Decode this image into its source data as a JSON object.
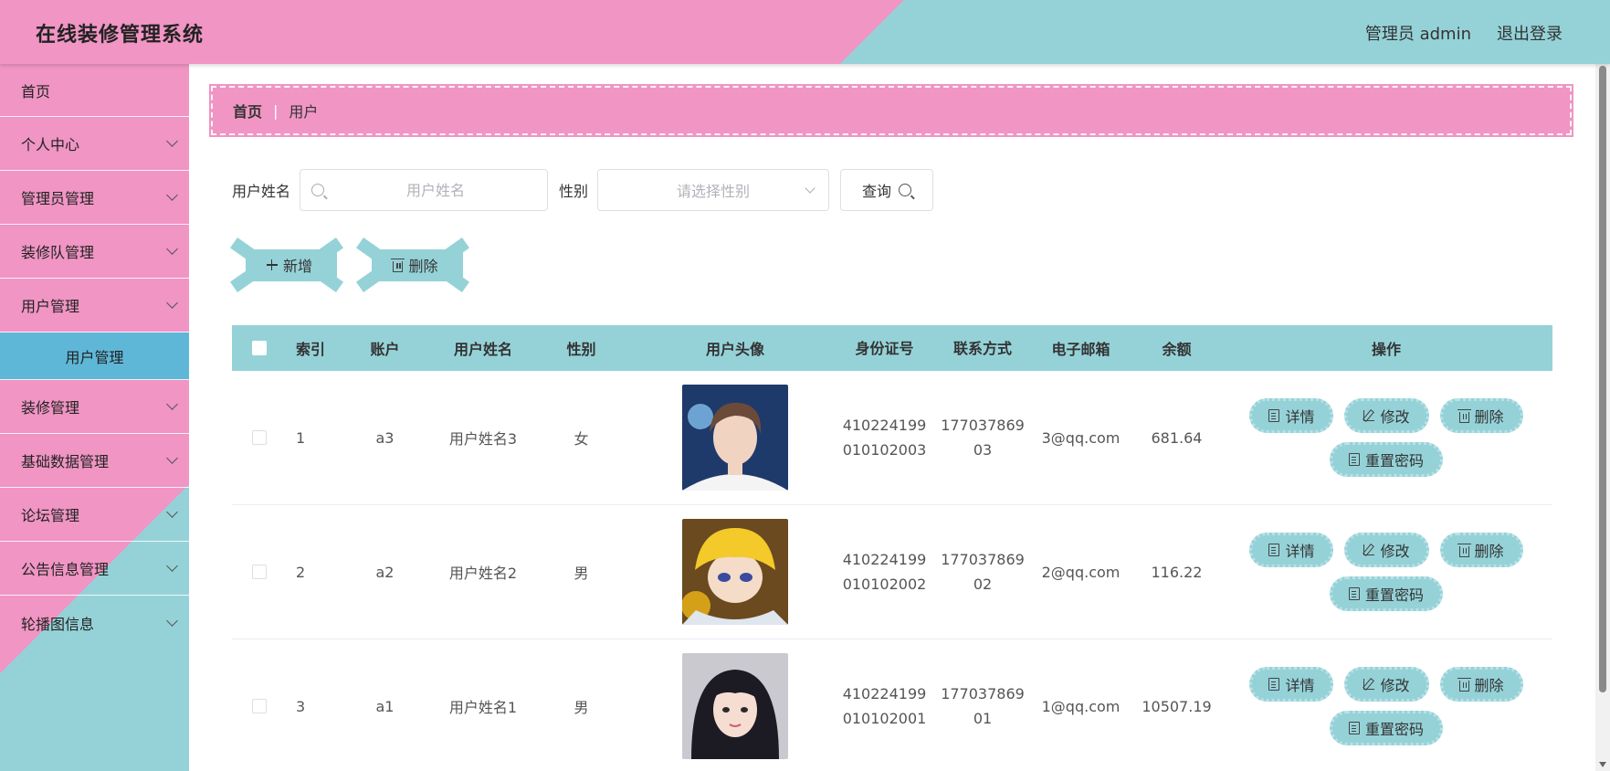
{
  "app": {
    "title": "在线装修管理系统"
  },
  "header": {
    "user_label": "管理员 admin",
    "logout_label": "退出登录"
  },
  "sidebar": {
    "items": [
      {
        "label": "首页"
      },
      {
        "label": "个人中心"
      },
      {
        "label": "管理员管理"
      },
      {
        "label": "装修队管理"
      },
      {
        "label": "用户管理"
      },
      {
        "label": "用户管理",
        "sub": true,
        "active": true
      },
      {
        "label": "装修管理"
      },
      {
        "label": "基础数据管理"
      },
      {
        "label": "论坛管理"
      },
      {
        "label": "公告信息管理"
      },
      {
        "label": "轮播图信息"
      }
    ]
  },
  "breadcrumb": {
    "home": "首页",
    "separator": "|",
    "current": "用户"
  },
  "search": {
    "name_label": "用户姓名",
    "name_placeholder": "用户姓名",
    "gender_label": "性别",
    "gender_placeholder": "请选择性别",
    "query_label": "查询"
  },
  "actions": {
    "add_label": "新增",
    "delete_label": "删除"
  },
  "table": {
    "headers": {
      "index": "索引",
      "account": "账户",
      "name": "用户姓名",
      "gender": "性别",
      "avatar": "用户头像",
      "id_number": "身份证号",
      "phone": "联系方式",
      "email": "电子邮箱",
      "balance": "余额",
      "ops": "操作"
    },
    "rows": [
      {
        "index": "1",
        "account": "a3",
        "name": "用户姓名3",
        "gender": "女",
        "id_line1": "410224199",
        "id_line2": "010102003",
        "phone_line1": "177037869",
        "phone_line2": "03",
        "email": "3@qq.com",
        "balance": "681.64"
      },
      {
        "index": "2",
        "account": "a2",
        "name": "用户姓名2",
        "gender": "男",
        "id_line1": "410224199",
        "id_line2": "010102002",
        "phone_line1": "177037869",
        "phone_line2": "02",
        "email": "2@qq.com",
        "balance": "116.22"
      },
      {
        "index": "3",
        "account": "a1",
        "name": "用户姓名1",
        "gender": "男",
        "id_line1": "410224199",
        "id_line2": "010102001",
        "phone_line1": "177037869",
        "phone_line2": "01",
        "email": "1@qq.com",
        "balance": "10507.19"
      }
    ],
    "ops": {
      "detail": "详情",
      "edit": "修改",
      "delete": "删除",
      "reset": "重置密码"
    }
  },
  "colors": {
    "pink": "#f095c4",
    "teal": "#95d2d8",
    "active_blue": "#5fb7d8"
  },
  "icons": [
    "search-icon",
    "chevron-down-icon",
    "plus-icon",
    "trash-icon",
    "document-icon",
    "edit-icon"
  ]
}
